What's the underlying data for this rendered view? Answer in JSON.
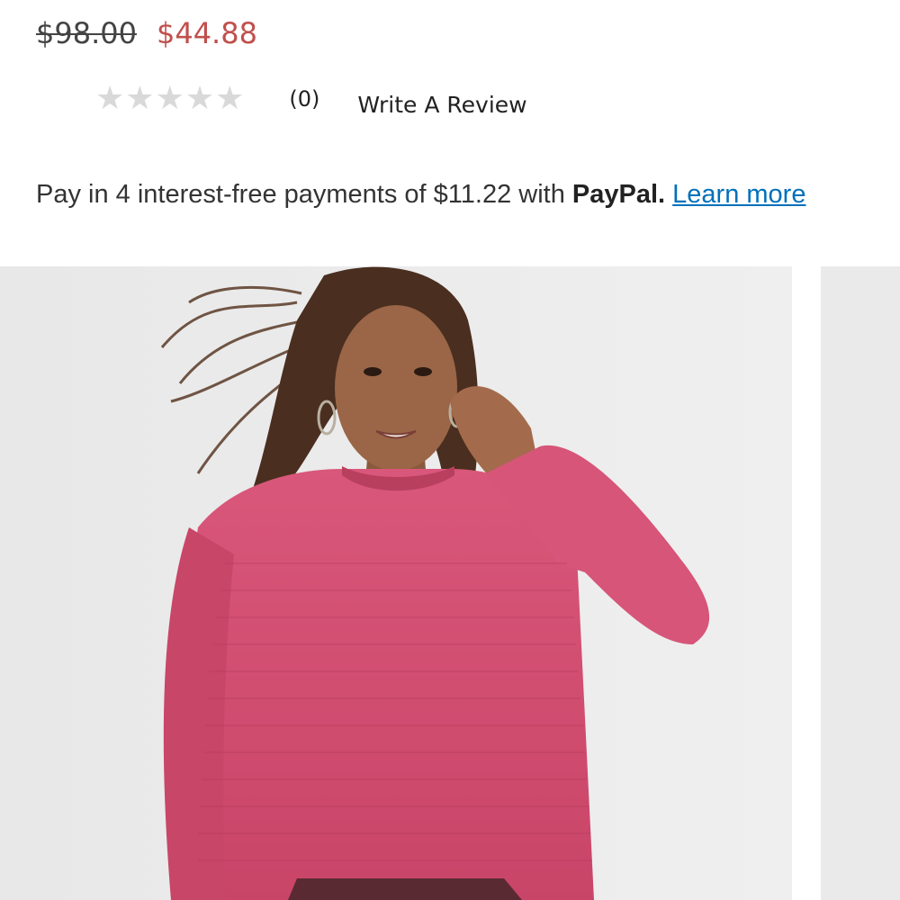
{
  "product": {
    "price_original": "$98.00",
    "price_sale": "$44.88",
    "price_sale_color": "#c0504d"
  },
  "rating": {
    "stars_filled": 0,
    "stars_total": 5,
    "review_count": "(0)",
    "write_review_label": "Write A Review"
  },
  "paypal": {
    "text_prefix": "Pay in 4 interest-free payments of $11.22 with",
    "brand": "PayPal.",
    "learn_more_label": "Learn more",
    "link_color": "#0070ba"
  },
  "gallery": {
    "main_image": "model-in-pink-sweater-photo",
    "sweater_color": "#d4506f",
    "background_color": "#ececec"
  }
}
